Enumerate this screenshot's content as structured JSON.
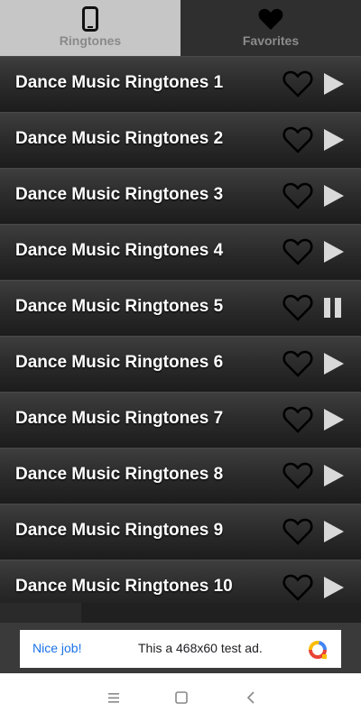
{
  "tabs": [
    {
      "label": "Ringtones",
      "icon": "phone-icon",
      "active": true
    },
    {
      "label": "Favorites",
      "icon": "heart-icon",
      "active": false
    }
  ],
  "ringtones": [
    {
      "title": "Dance Music Ringtones 1",
      "state": "play"
    },
    {
      "title": "Dance Music Ringtones 2",
      "state": "play"
    },
    {
      "title": "Dance Music Ringtones 3",
      "state": "play"
    },
    {
      "title": "Dance Music Ringtones 4",
      "state": "play"
    },
    {
      "title": "Dance Music Ringtones 5",
      "state": "pause"
    },
    {
      "title": "Dance Music Ringtones 6",
      "state": "play"
    },
    {
      "title": "Dance Music Ringtones 7",
      "state": "play"
    },
    {
      "title": "Dance Music Ringtones 8",
      "state": "play"
    },
    {
      "title": "Dance Music Ringtones 9",
      "state": "play"
    },
    {
      "title": "Dance Music Ringtones 10",
      "state": "play"
    }
  ],
  "ad": {
    "left_label": "Nice job!",
    "text": "This a 468x60 test ad.",
    "logo": "ad-logo-icon"
  },
  "navbar": {
    "buttons": [
      "menu-icon",
      "home-square-icon",
      "back-chevron-icon"
    ]
  },
  "colors": {
    "tab_active_bg": "#c6c6c6",
    "tab_inactive_bg": "#2f2f2f",
    "ad_link": "#1a73e8"
  }
}
